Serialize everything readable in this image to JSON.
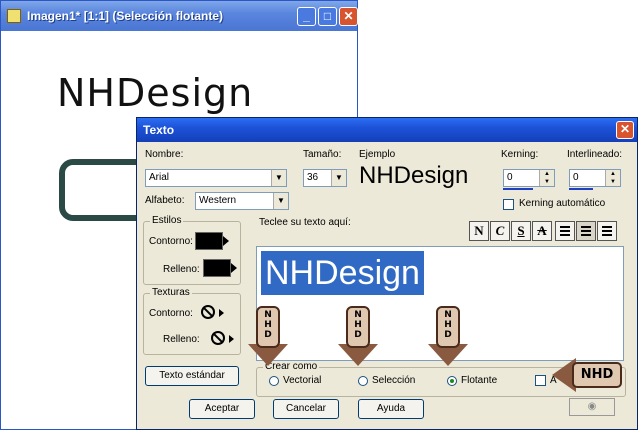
{
  "image_window": {
    "title": "Imagen1* [1:1] (Selección flotante)",
    "canvas_text": "NHDesign",
    "buttons": {
      "minimize": "_",
      "maximize": "□",
      "close": "✕"
    }
  },
  "dialog": {
    "title": "Texto",
    "close": "✕",
    "labels": {
      "nombre": "Nombre:",
      "tamano": "Tamaño:",
      "ejemplo": "Ejemplo",
      "kerning": "Kerning:",
      "interlineado": "Interlineado:",
      "alfabeto": "Alfabeto:",
      "kerning_auto": "Kerning automático",
      "teclee": "Teclee su texto aquí:",
      "estilos": "Estilos",
      "contorno": "Contorno:",
      "relleno": "Relleno:",
      "texturas": "Texturas",
      "crear_como": "Crear como"
    },
    "font_name": "Arial",
    "font_size": "36",
    "alphabet": "Western",
    "preview": "NHDesign",
    "kerning_value": "0",
    "interlineado_value": "0",
    "text_content": "NHDesign",
    "format_buttons": [
      "N",
      "C",
      "S",
      "A"
    ],
    "radios": [
      {
        "label": "Vectorial",
        "checked": false
      },
      {
        "label": "Selección",
        "checked": false
      },
      {
        "label": "Flotante",
        "checked": true
      }
    ],
    "antialias_label": "A",
    "buttons": {
      "texto_estandar": "Texto estándar",
      "aceptar": "Aceptar",
      "cancelar": "Cancelar",
      "ayuda": "Ayuda"
    },
    "watermark": "NHD"
  },
  "colors": {
    "title_blue": "#1c52d8",
    "dialog_bg": "#ece9d8",
    "selection": "#316ac5"
  }
}
